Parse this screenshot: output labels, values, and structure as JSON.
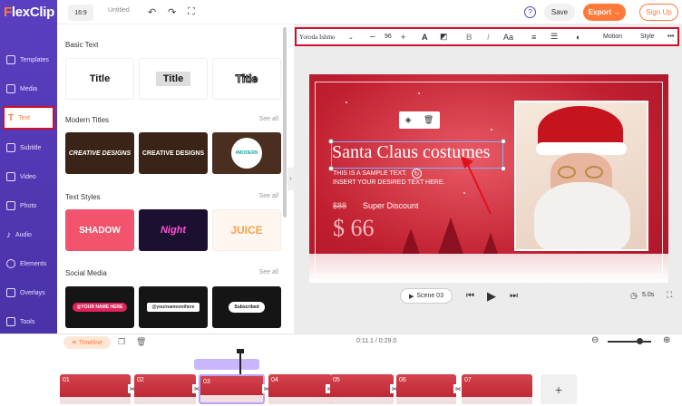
{
  "app": {
    "logo_prefix": "F",
    "logo_rest": "lexClip"
  },
  "sidebar": {
    "items": [
      {
        "label": "Templates"
      },
      {
        "label": "Media"
      },
      {
        "label": "Text"
      },
      {
        "label": "Subtitle"
      },
      {
        "label": "Video"
      },
      {
        "label": "Photo"
      },
      {
        "label": "Audio"
      },
      {
        "label": "Elements"
      },
      {
        "label": "Overlays"
      },
      {
        "label": "Tools"
      }
    ]
  },
  "topbar": {
    "ratio": "16:9",
    "project_title": "Untitled",
    "save_label": "Save",
    "export_label": "Export →",
    "signup_label": "Sign Up"
  },
  "panel": {
    "basic_text": {
      "title": "Basic Text",
      "tiles": [
        "Title",
        "Title",
        "Title"
      ]
    },
    "modern_titles": {
      "title": "Modern Titles",
      "see_all": "See all",
      "tiles": [
        "CREATIVE DESIGNS",
        "CREATIVE DESIGNS",
        "#MODERN"
      ]
    },
    "text_styles": {
      "title": "Text Styles",
      "see_all": "See all",
      "tiles": [
        "SHADOW",
        "Night",
        "JUICE"
      ]
    },
    "social_media": {
      "title": "Social Media",
      "see_all": "See all",
      "tiles": [
        "@YOUR NAME HERE",
        "@yournameonthere",
        "Subscribed"
      ]
    }
  },
  "format_toolbar": {
    "font": "Yoroda Ishmo",
    "font_size": "96",
    "motion_label": "Motion",
    "style_label": "Style"
  },
  "slide": {
    "title": "Santa Claus costumes",
    "sample_line1": "THIS IS A SAMPLE TEXT.",
    "sample_line2": "INSERT YOUR DESIRED TEXT HERE.",
    "old_price": "$88",
    "discount_label": "Super Discount",
    "new_price": "$ 66"
  },
  "player": {
    "scene_label": "Scene 03",
    "duration": "5.0s"
  },
  "timeline": {
    "label": "Timeline",
    "time": "0:11.1 / 0:29.0",
    "clips": [
      "01",
      "02",
      "03",
      "04",
      "05",
      "06",
      "07"
    ]
  },
  "colors": {
    "accent": "#ff7a3a",
    "sidebar": "#5a3fc0",
    "highlight": "#d0102a"
  }
}
